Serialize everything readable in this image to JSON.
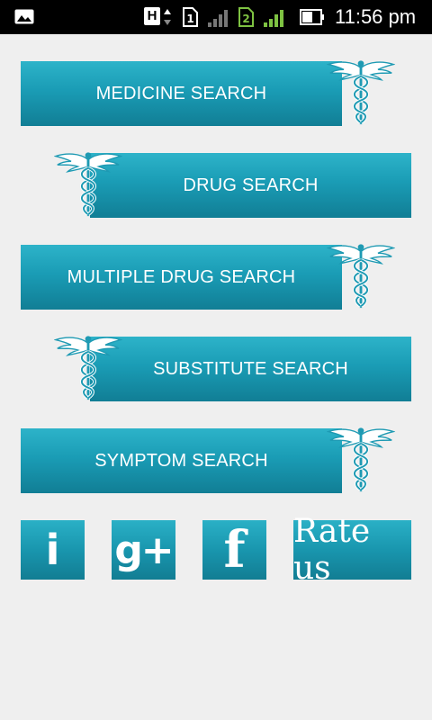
{
  "status_bar": {
    "time": "11:56 pm",
    "network_badge": "H",
    "sim1_label": "1",
    "sim2_label": "2",
    "icons": [
      "gallery-icon",
      "network-arrows-icon",
      "sim1-icon",
      "signal1-icon",
      "sim2-icon",
      "signal2-icon",
      "battery-icon"
    ]
  },
  "menu": {
    "medicine_search": "MEDICINE SEARCH",
    "drug_search": "DRUG SEARCH",
    "multiple_drug_search": "MULTIPLE DRUG SEARCH",
    "substitute_search": "SUBSTITUTE SEARCH",
    "symptom_search": "SYMPTOM SEARCH"
  },
  "actions": {
    "info": "i",
    "google_plus": "g+",
    "facebook": "f",
    "rate_us": "Rate us"
  },
  "colors": {
    "button_top": "#2db3c9",
    "button_bottom": "#117e95",
    "background": "#efefef",
    "caduceus": "#1e9ab3"
  }
}
